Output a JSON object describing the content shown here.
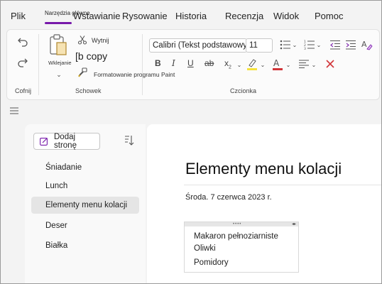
{
  "tabs": {
    "file": "Plik",
    "home_tools": "Narzędzia główne",
    "insert": "Wstawianie",
    "draw": "Rysowanie",
    "history": "Historia",
    "review": "Recenzja",
    "view": "Widok",
    "help": "Pomoc"
  },
  "ribbon": {
    "undo_group_label": "Cofnij",
    "clipboard": {
      "paste_label": "Wklejanie",
      "cut_label": "Wytnij",
      "copy_label": "[b copy",
      "format_painter_label": "Formatowanie programu Paint",
      "group_label": "Schowek"
    },
    "font": {
      "font_name": "Calibri (Tekst podstawowy)",
      "font_size": "11",
      "group_label": "Czcionka",
      "highlight_color": "#f5e23c",
      "font_color": "#d13438"
    }
  },
  "pages_pane": {
    "add_page_label": "Dodaj stronę",
    "items": [
      {
        "label": "Śniadanie"
      },
      {
        "label": "Lunch"
      },
      {
        "label": "Elementy menu kolacji",
        "active": true
      },
      {
        "label": "Deser"
      },
      {
        "label": "Białka"
      }
    ]
  },
  "note": {
    "title": "Elementy menu kolacji",
    "date": "Środa. 7 czerwca 2023 r.",
    "lines": [
      "Makaron pełnoziarniste",
      "Oliwki",
      "Pomidory"
    ]
  },
  "colors": {
    "accent": "#7719aa",
    "delete_red": "#d13438"
  }
}
